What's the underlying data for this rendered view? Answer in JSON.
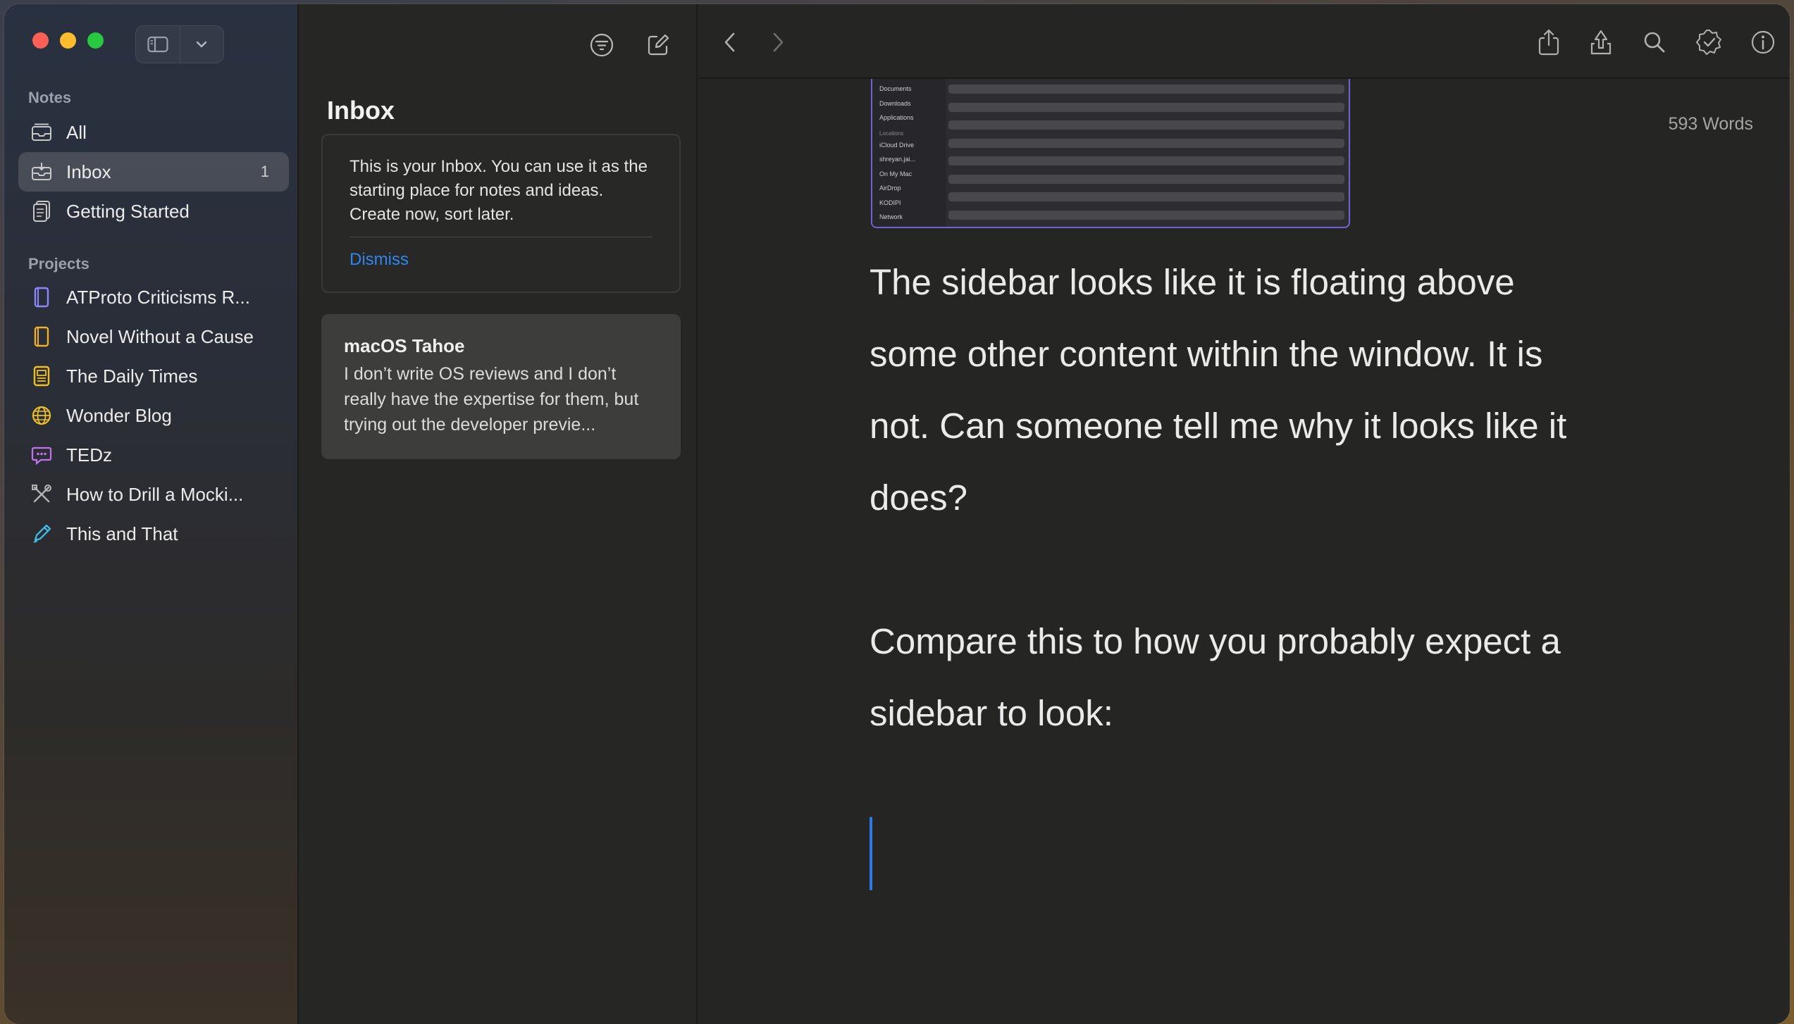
{
  "sidebar": {
    "notes_label": "Notes",
    "projects_label": "Projects",
    "notes": [
      {
        "label": "All",
        "icon": "tray-stack-icon"
      },
      {
        "label": "Inbox",
        "icon": "inbox-icon",
        "count": "1"
      },
      {
        "label": "Getting Started",
        "icon": "document-icon"
      }
    ],
    "projects": [
      {
        "label": "ATProto Criticisms R...",
        "icon": "book-icon",
        "color": "#8e86ff"
      },
      {
        "label": "Novel Without a Cause",
        "icon": "book-icon",
        "color": "#f0b024"
      },
      {
        "label": "The Daily Times",
        "icon": "newspaper-icon",
        "color": "#f0c020"
      },
      {
        "label": "Wonder Blog",
        "icon": "globe-icon",
        "color": "#f0c020"
      },
      {
        "label": "TEDz",
        "icon": "speech-bubble-icon",
        "color": "#c472f0"
      },
      {
        "label": "How to Drill a Mocki...",
        "icon": "tools-icon",
        "color": "#b4b4b4"
      },
      {
        "label": "This and That",
        "icon": "pencil-icon",
        "color": "#3fc2f0"
      }
    ]
  },
  "list": {
    "title": "Inbox",
    "inbox_message": "This is your Inbox. You can use it as the starting place for notes and ideas. Create now, sort later.",
    "dismiss_label": "Dismiss",
    "notes": [
      {
        "title": "macOS Tahoe",
        "snippet": "I don’t write OS reviews and I don’t really have the expertise for them, but trying out the developer previe..."
      }
    ]
  },
  "editor": {
    "word_count": "593 Words",
    "thumbnail_items": [
      "Documents",
      "Downloads",
      "Applications"
    ],
    "thumbnail_section": "Locations",
    "thumbnail_locations": [
      "iCloud Drive",
      "shreyan.jai...",
      "On My Mac",
      "AirDrop",
      "KODIPI",
      "Network"
    ],
    "paragraphs": [
      "The sidebar looks like it is floating above some other content within the window. It is not. Can someone tell me why it looks like it does?",
      "Compare this to how you probably expect a sidebar to look:"
    ]
  },
  "colors": {
    "accent": "#2f86f0",
    "close": "#fe5f57",
    "minimize": "#febc2e",
    "zoom": "#28c840"
  }
}
